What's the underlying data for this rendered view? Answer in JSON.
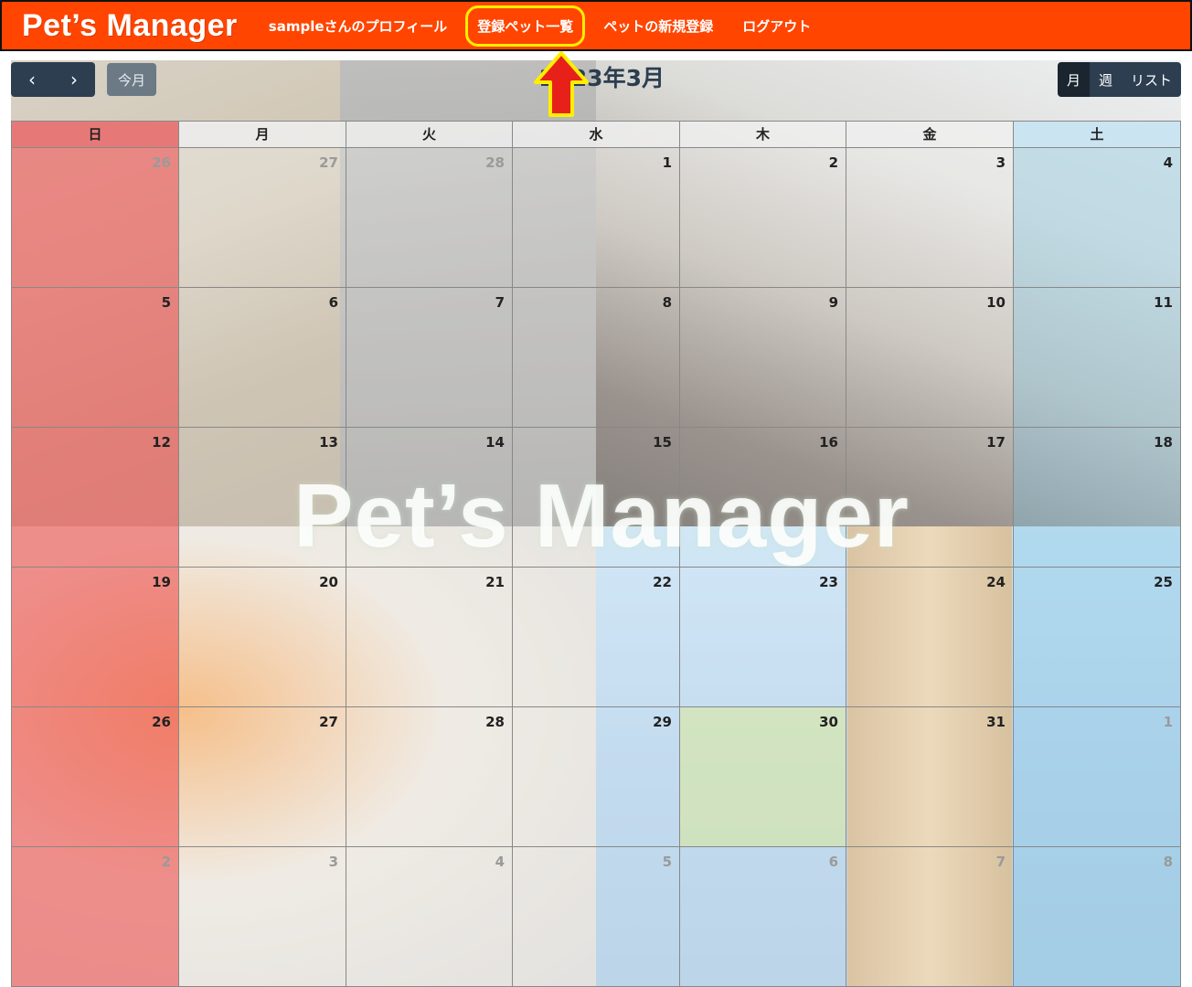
{
  "navbar": {
    "brand": "Pet’s Manager",
    "links": [
      {
        "label": "sampleさんのプロフィール"
      },
      {
        "label": "登録ペット一覧"
      },
      {
        "label": "ペットの新規登録"
      },
      {
        "label": "ログアウト"
      }
    ],
    "highlight_color": "#ffee00",
    "background_color": "#ff4500"
  },
  "toolbar": {
    "prev_icon": "‹",
    "next_icon": "›",
    "today_label": "今月",
    "title": "2023年3月",
    "views": [
      {
        "label": "月",
        "active": true
      },
      {
        "label": "週",
        "active": false
      },
      {
        "label": "リスト",
        "active": false
      }
    ]
  },
  "calendar": {
    "weekdays": [
      "日",
      "月",
      "火",
      "水",
      "木",
      "金",
      "土"
    ],
    "weeks": [
      [
        {
          "d": "26",
          "other": true
        },
        {
          "d": "27",
          "other": true
        },
        {
          "d": "28",
          "other": true
        },
        {
          "d": "1"
        },
        {
          "d": "2"
        },
        {
          "d": "3"
        },
        {
          "d": "4"
        }
      ],
      [
        {
          "d": "5"
        },
        {
          "d": "6"
        },
        {
          "d": "7"
        },
        {
          "d": "8"
        },
        {
          "d": "9"
        },
        {
          "d": "10"
        },
        {
          "d": "11"
        }
      ],
      [
        {
          "d": "12"
        },
        {
          "d": "13"
        },
        {
          "d": "14"
        },
        {
          "d": "15"
        },
        {
          "d": "16"
        },
        {
          "d": "17"
        },
        {
          "d": "18"
        }
      ],
      [
        {
          "d": "19"
        },
        {
          "d": "20"
        },
        {
          "d": "21"
        },
        {
          "d": "22"
        },
        {
          "d": "23"
        },
        {
          "d": "24"
        },
        {
          "d": "25"
        }
      ],
      [
        {
          "d": "26"
        },
        {
          "d": "27"
        },
        {
          "d": "28"
        },
        {
          "d": "29"
        },
        {
          "d": "30",
          "today": true
        },
        {
          "d": "31"
        },
        {
          "d": "1",
          "other": true
        }
      ],
      [
        {
          "d": "2",
          "other": true
        },
        {
          "d": "3",
          "other": true
        },
        {
          "d": "4",
          "other": true
        },
        {
          "d": "5",
          "other": true
        },
        {
          "d": "6",
          "other": true
        },
        {
          "d": "7",
          "other": true
        },
        {
          "d": "8",
          "other": true
        }
      ]
    ]
  },
  "watermark": "Pet’s Manager",
  "annotation": {
    "arrow_color": "#e8201a",
    "arrow_outline": "#ffee00"
  }
}
